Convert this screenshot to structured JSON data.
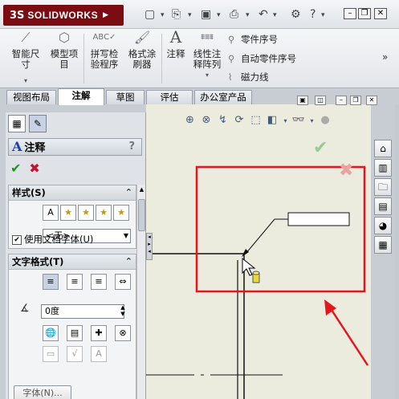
{
  "app": {
    "brand_prefix": "3S",
    "brand": "SOLIDWORKS"
  },
  "ribbon": {
    "smart_dimension": "智能尺\n寸",
    "model_items": "模型项\n目",
    "spell_check": "拼写检\n验程序",
    "format_painter": "格式涂\n刷器",
    "note": "注释",
    "linear_note_pattern": "线性注\n释阵列",
    "balloon": "零件序号",
    "auto_balloon": "自动零件序号",
    "magnetic_line": "磁力线"
  },
  "tabs": [
    {
      "label": "视图布局"
    },
    {
      "label": "注解"
    },
    {
      "label": "草图"
    },
    {
      "label": "评估"
    },
    {
      "label": "办公室产品"
    }
  ],
  "panel": {
    "title": "注释",
    "help": "?",
    "style_section": "样式(S)",
    "style_value": "<无>",
    "text_format_section": "文字格式(T)",
    "angle_value": "0度",
    "use_doc_font": "使用文档字体(U)",
    "font_button": "字体(N)..."
  },
  "colors": {
    "brand": "#7b0d12",
    "highlight": "#e8141c",
    "accept": "#1a9a1a",
    "cancel": "#c8102e"
  }
}
